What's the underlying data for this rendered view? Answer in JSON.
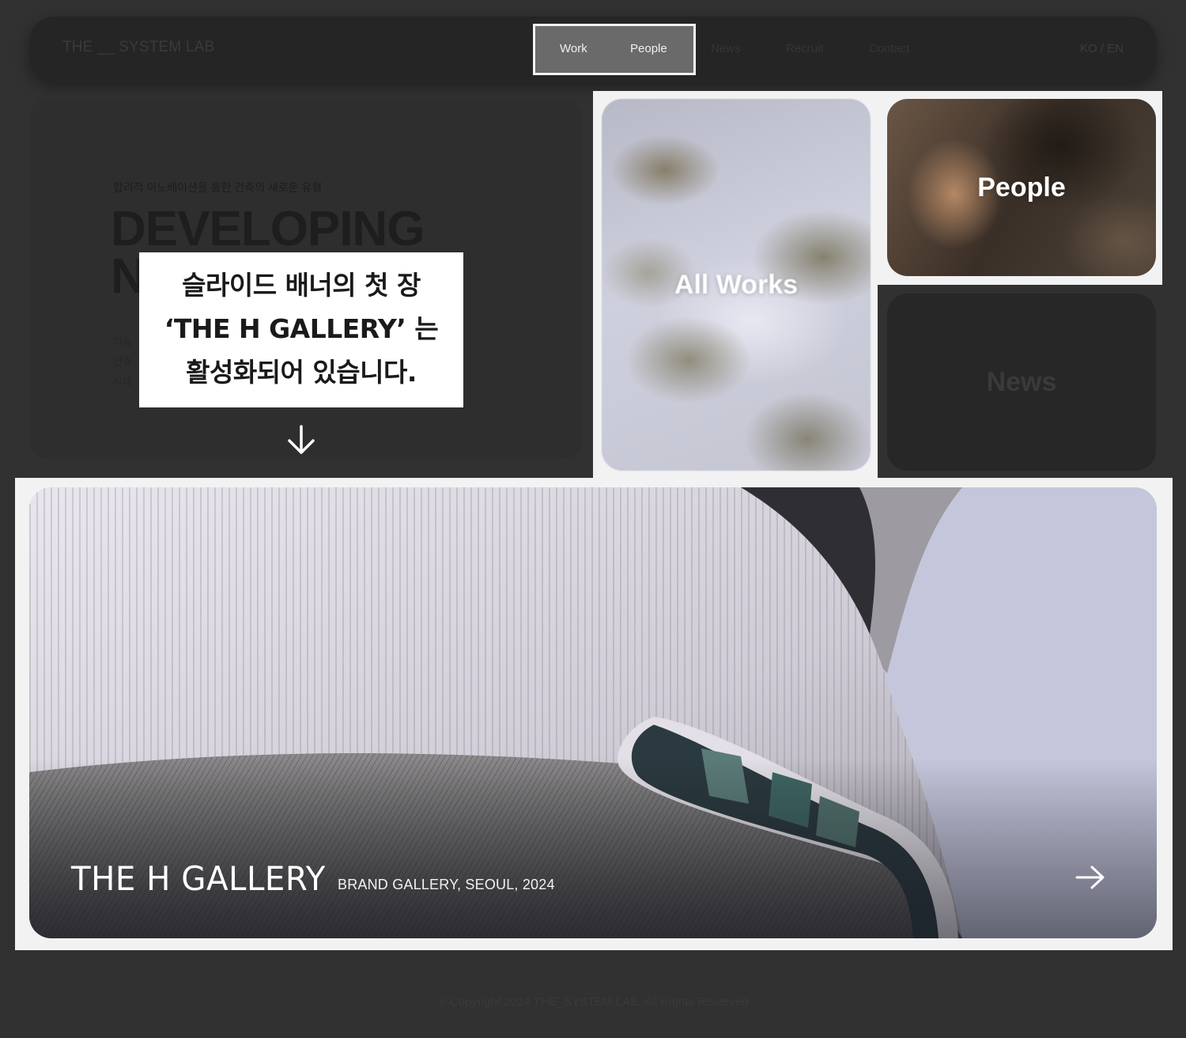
{
  "header": {
    "logo": "THE __ SYSTEM LAB",
    "nav": [
      "Work",
      "People",
      "News",
      "Recruit",
      "Contact"
    ],
    "lang": "KO / EN"
  },
  "hero": {
    "subtitle": "합리적 이노베이션을 통한 건축의 새로운 유형",
    "headline_1": "DEVELOPING",
    "headline_2": "N                  Y",
    "body_line_1": "기술",
    "body_line_2": "건축",
    "body_line_3": "시대"
  },
  "callout": {
    "line_1": "슬라이드 배너의 첫 장",
    "line_2": "‘THE H GALLERY’ 는",
    "line_3": "활성화되어 있습니다."
  },
  "cards": {
    "works": "All Works",
    "people": "People",
    "news": "News"
  },
  "banner": {
    "title": "THE H GALLERY",
    "subtitle": "BRAND GALLERY, SEOUL, 2024"
  },
  "footer": {
    "copyright": "© Copyright 2024 THE_SYSTEM LAB. All Rights Reserved"
  },
  "colors": {
    "background": "#313131",
    "header": "#252525",
    "highlight_frame": "#f2f2f2"
  }
}
